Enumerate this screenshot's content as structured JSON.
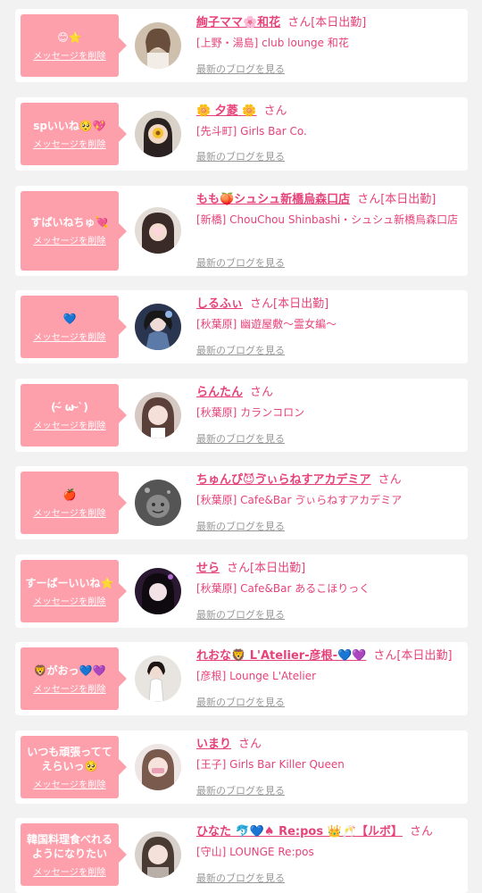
{
  "delete_label": "メッセージを削除",
  "blog_label": "最新のブログを見る",
  "san_suffix": "さん",
  "colors": {
    "accent": "#e6427a",
    "bubble": "#fe9fac",
    "background": "#f2f2f2",
    "link_gray": "#999999"
  },
  "items": [
    {
      "message": "😊⭐",
      "name": "絢子ママ🌸和花",
      "status": "[本日出勤]",
      "store": "[上野・湯島] club lounge 和花"
    },
    {
      "message": "spいいね🥺💖",
      "name": "🌼 夕菱 🌼",
      "status": "",
      "store": "[先斗町] Girls Bar Co."
    },
    {
      "message": "すぱいねちゅ💘",
      "name": "もも🍑シュシュ新橋烏森口店",
      "status": "[本日出勤]",
      "store": "[新橋] ChouChou Shinbashi・シュシュ新橋烏森口店"
    },
    {
      "message": "💙",
      "name": "しるふぃ",
      "status": "[本日出勤]",
      "store": "[秋葉原] 幽遊屋敷〜霊女編〜"
    },
    {
      "message": "(´̴ ω ̴`)",
      "name": "らんたん",
      "status": "",
      "store": "[秋葉原] カランコロン"
    },
    {
      "message": "🍎",
      "name": "ちゅんぴ😈ゔぃらねすアカデミア",
      "status": "",
      "store": "[秋葉原] Cafe&Bar ゔぃらねすアカデミア"
    },
    {
      "message": "すーぱーいいね⭐",
      "name": "せら",
      "status": "[本日出勤]",
      "store": "[秋葉原] Cafe&Bar あるこほりっく"
    },
    {
      "message": "🦁がおっ💙💜",
      "name": "れおな🦁 L'Atelier-彦根-💙💜",
      "status": "[本日出勤]",
      "store": "[彦根] Lounge L'Atelier"
    },
    {
      "message": "いつも頑張ってて\nえらいっ🥺",
      "name": "いまり",
      "status": "",
      "store": "[王子] Girls Bar Killer Queen"
    },
    {
      "message": "韓国料理食べれる\nようになりたい",
      "name": "ひなた 🐬💙♠ Re:pos 👑🥂【ルボ】",
      "status": "",
      "store": "[守山] LOUNGE Re:pos"
    }
  ]
}
